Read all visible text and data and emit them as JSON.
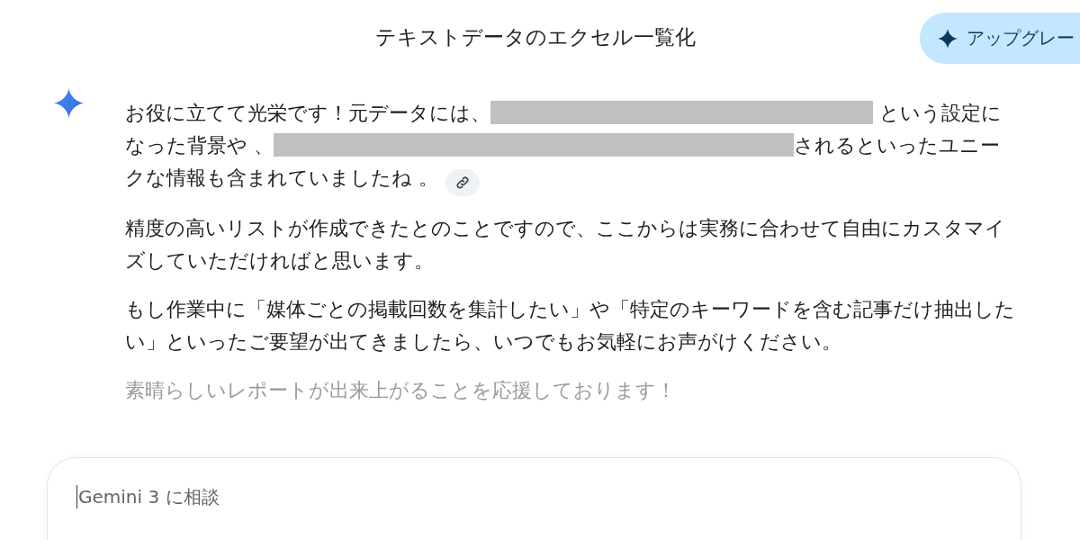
{
  "header": {
    "title": "テキストデータのエクセル一覧化",
    "upgrade_button": "アップグレー"
  },
  "response": {
    "paragraphs": [
      {
        "segments": [
          {
            "kind": "text",
            "text": "お役に立てて光栄です！元データには、"
          },
          {
            "kind": "redacted"
          },
          {
            "kind": "text",
            "text": " という設定になった背景や 、"
          },
          {
            "kind": "redacted"
          },
          {
            "kind": "text",
            "text": "されるといったユニークな情報も含まれていましたね 。"
          }
        ],
        "source_link": true,
        "faded": false
      },
      {
        "segments": [
          {
            "kind": "text",
            "text": "精度の高いリストが作成できたとのことですので、ここからは実務に合わせて自由にカスタマイズしていただければと思います。"
          }
        ],
        "source_link": false,
        "faded": false
      },
      {
        "segments": [
          {
            "kind": "text",
            "text": "もし作業中に「媒体ごとの掲載回数を集計したい」や「特定のキーワードを含む記事だけ抽出したい」といったご要望が出てきましたら、いつでもお気軽にお声がけください。"
          }
        ],
        "source_link": false,
        "faded": false
      },
      {
        "segments": [
          {
            "kind": "text",
            "text": "素晴らしいレポートが出来上がることを応援しております！"
          }
        ],
        "source_link": false,
        "faded": true
      }
    ]
  },
  "prompt": {
    "placeholder": "Gemini 3 に相談"
  }
}
